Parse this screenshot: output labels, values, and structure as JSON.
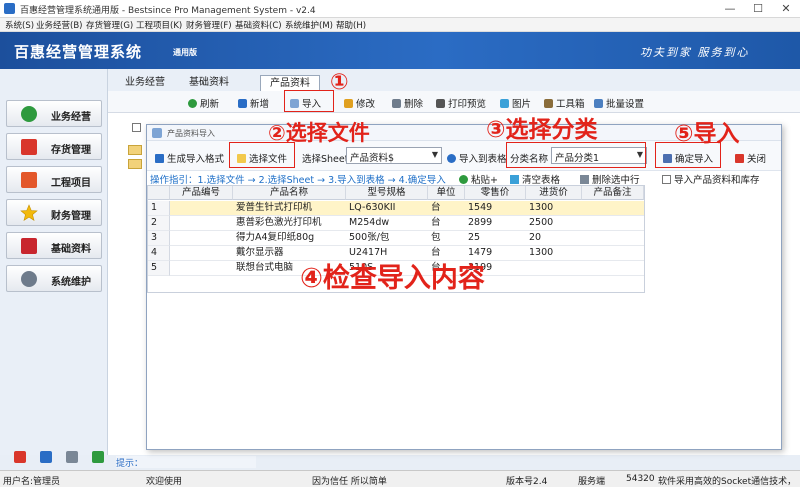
{
  "titlebar": {
    "title": "百惠经营管理系统通用版 - Bestsince Pro Management System - v2.4",
    "min_icon": "—",
    "max_icon": "☐",
    "close_icon": "✕"
  },
  "menubar": {
    "items": [
      "系统(S)",
      "业务经营(B)",
      "存货管理(G)",
      "工程项目(K)",
      "财务管理(F)",
      "基础资料(C)",
      "系统维护(M)",
      "帮助(H)"
    ]
  },
  "banner": {
    "brand": "百惠经营管理系统",
    "brand_sub": "通用版",
    "slogan": "功夫到家 服务到心"
  },
  "leftnav": {
    "items": [
      {
        "label": "业务经营",
        "icon": "check-icon",
        "color": "#2e9a3e"
      },
      {
        "label": "存货管理",
        "icon": "house-icon",
        "color": "#d9362b"
      },
      {
        "label": "工程项目",
        "icon": "blocks-icon",
        "color": "#e3572a"
      },
      {
        "label": "财务管理",
        "icon": "star-icon",
        "color": "#f2b90c"
      },
      {
        "label": "基础资料",
        "icon": "book-icon",
        "color": "#c8262e"
      },
      {
        "label": "系统维护",
        "icon": "gear-icon",
        "color": "#6e7b8b"
      }
    ]
  },
  "tabs": [
    "业务经营",
    "基础资料",
    "产品资料"
  ],
  "toolbar": [
    "刷新",
    "新增",
    "导入",
    "修改",
    "删除",
    "打印预览",
    "图片",
    "工具箱",
    "批量设置"
  ],
  "main_hint": "提示：",
  "dialog": {
    "title": "产品资料导入",
    "tools": {
      "generate": "生成导入格式",
      "select_file": "选择文件",
      "select_sheet_label": "选择Sheet",
      "sheet_value": "产品资料$",
      "import_to_table": "导入到表格",
      "category_label": "分类名称",
      "category_value": "产品分类1",
      "confirm": "确定导入",
      "close": "关闭"
    },
    "guide": {
      "text": "操作指引：1.选择文件 → 2.选择Sheet → 3.导入到表格 → 4.确定导入",
      "paste": "粘贴+",
      "clear": "清空表格",
      "delete_row": "删除选中行",
      "import_stock": "导入产品资料和库存"
    },
    "grid": {
      "headers": [
        "产品编号",
        "产品名称",
        "型号规格",
        "单位",
        "零售价",
        "进货价",
        "产品备注"
      ],
      "rows": [
        {
          "no": "1",
          "code": "",
          "name": "爱普生针式打印机",
          "model": "LQ-630KII",
          "unit": "台",
          "retail": "1549",
          "cost": "1300",
          "note": ""
        },
        {
          "no": "2",
          "code": "",
          "name": "惠普彩色激光打印机",
          "model": "M254dw",
          "unit": "台",
          "retail": "2899",
          "cost": "2500",
          "note": ""
        },
        {
          "no": "3",
          "code": "",
          "name": "得力A4复印纸80g",
          "model": "500张/包",
          "unit": "包",
          "retail": "25",
          "cost": "20",
          "note": ""
        },
        {
          "no": "4",
          "code": "",
          "name": "戴尔显示器",
          "model": "U2417H",
          "unit": "台",
          "retail": "1479",
          "cost": "1300",
          "note": ""
        },
        {
          "no": "5",
          "code": "",
          "name": "联想台式电脑",
          "model": "510S",
          "unit": "台",
          "retail": "3199",
          "cost": "",
          "note": ""
        }
      ]
    }
  },
  "annotations": {
    "a1": "①",
    "a2": "②选择文件",
    "a3": "③选择分类",
    "a4": "④检查导入内容",
    "a5": "⑤导入"
  },
  "statusbar": {
    "user": "用户名:管理员",
    "welcome": "欢迎使用",
    "motto": "因为信任 所以简单",
    "version": "版本号2.4",
    "server_label": "服务端",
    "port": "54320",
    "socket_note": "软件采用高效的Socket通信技术，"
  }
}
